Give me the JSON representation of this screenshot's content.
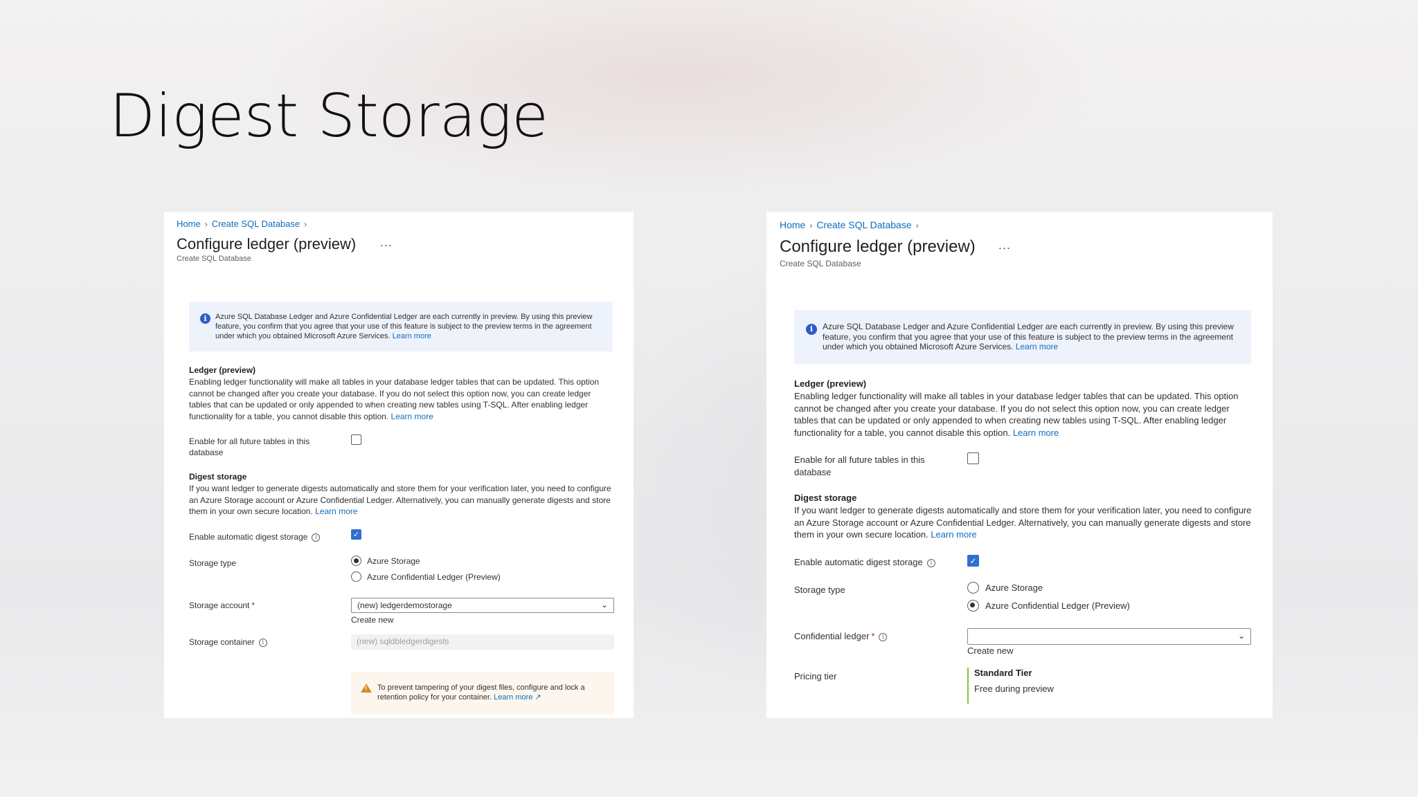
{
  "slide": {
    "title": "Digest Storage"
  },
  "colors": {
    "link": "#0f6cbd",
    "checkbox_checked": "#2f6fd0",
    "info_bg": "#eef2fb",
    "warning": "#d38b1e",
    "tier_accent": "#8cbf3f"
  },
  "panels": [
    {
      "breadcrumb": [
        "Home",
        "Create SQL Database"
      ],
      "title": "Configure ledger (preview)",
      "more": "...",
      "subtitle": "Create SQL Database",
      "info_text": "Azure SQL Database Ledger and Azure Confidential Ledger are each currently in preview. By using this preview feature, you confirm that you agree that your use of this feature is subject to the preview terms in the agreement under which you obtained Microsoft Azure Services.",
      "learn_more": "Learn more",
      "ledger_heading": "Ledger (preview)",
      "ledger_desc": "Enabling ledger functionality will make all tables in your database ledger tables that can be updated. This option cannot be changed after you create your database. If you do not select this option now, you can create ledger tables that can be updated or only appended to when creating new tables using T-SQL. After enabling ledger functionality for a table, you cannot disable this option.",
      "enable_future_label": "Enable for all future tables in this database",
      "enable_future_checked": false,
      "digest_heading": "Digest storage",
      "digest_desc": "If you want ledger to generate digests automatically and store them for your verification later, you need to configure an Azure Storage account or Azure Confidential Ledger. Alternatively, you can manually generate digests and store them in your own secure location.",
      "auto_digest_label": "Enable automatic digest storage",
      "auto_digest_checked": true,
      "storage_type_label": "Storage type",
      "storage_options": [
        "Azure Storage",
        "Azure Confidential Ledger (Preview)"
      ],
      "storage_selected": "Azure Storage",
      "storage_account_label": "Storage account",
      "storage_account_value": "(new) ledgerdemostorage",
      "create_new": "Create new",
      "storage_container_label": "Storage container",
      "storage_container_value": "(new) sqldbledgerdigests",
      "warning_text": "To prevent tampering of your digest files, configure and lock a retention policy for your container.",
      "warning_link": "Learn more"
    },
    {
      "breadcrumb": [
        "Home",
        "Create SQL Database"
      ],
      "title": "Configure ledger (preview)",
      "more": "...",
      "subtitle": "Create SQL Database",
      "info_text": "Azure SQL Database Ledger and Azure Confidential Ledger are each currently in preview. By using this preview feature, you confirm that you agree that your use of this feature is subject to the preview terms in the agreement under which you obtained Microsoft Azure Services.",
      "learn_more": "Learn more",
      "ledger_heading": "Ledger (preview)",
      "ledger_desc": "Enabling ledger functionality will make all tables in your database ledger tables that can be updated. This option cannot be changed after you create your database. If you do not select this option now, you can create ledger tables that can be updated or only appended to when creating new tables using T-SQL. After enabling ledger functionality for a table, you cannot disable this option.",
      "enable_future_label": "Enable for all future tables in this database",
      "enable_future_checked": false,
      "digest_heading": "Digest storage",
      "digest_desc": "If you want ledger to generate digests automatically and store them for your verification later, you need to configure an Azure Storage account or Azure Confidential Ledger. Alternatively, you can manually generate digests and store them in your own secure location.",
      "auto_digest_label": "Enable automatic digest storage",
      "auto_digest_checked": true,
      "storage_type_label": "Storage type",
      "storage_options": [
        "Azure Storage",
        "Azure Confidential Ledger (Preview)"
      ],
      "storage_selected": "Azure Confidential Ledger (Preview)",
      "confidential_ledger_label": "Confidential ledger",
      "confidential_ledger_value": "",
      "create_new": "Create new",
      "pricing_tier_label": "Pricing tier",
      "tier_name": "Standard Tier",
      "tier_desc": "Free during preview"
    }
  ]
}
